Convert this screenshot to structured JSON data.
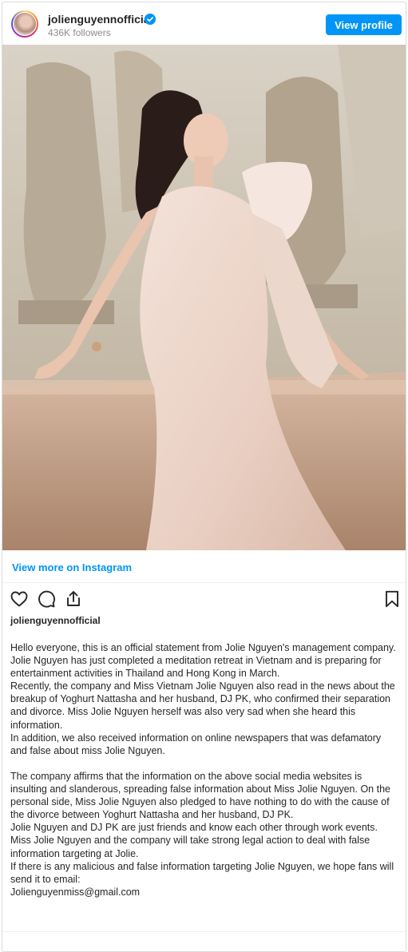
{
  "header": {
    "username": "jolienguyennofficial",
    "followers": "436K followers",
    "view_profile_label": "View profile"
  },
  "post": {
    "view_more_label": "View more on Instagram",
    "owner": "jolienguyennofficial",
    "caption": "Hello everyone, this is an official statement from Jolie Nguyen's management company.\nJolie Nguyen has just completed a meditation retreat in Vietnam and is preparing for entertainment activities in Thailand and Hong Kong in March.\nRecently, the company and Miss Vietnam Jolie Nguyen also read in the news about the breakup of Yoghurt Nattasha and her husband, DJ PK, who confirmed their separation and divorce. Miss Jolie Nguyen herself was also very sad when she heard this information.\nIn addition, we also received information on online newspapers that was defamatory and false about miss Jolie Nguyen.\n\nThe company affirms that the information on the above social media websites is insulting and slanderous, spreading false information about Miss Jolie Nguyen. On the personal side, Miss Jolie Nguyen also pledged to have nothing to do with the cause of the divorce between Yoghurt Nattasha and her husband, DJ PK.\nJolie Nguyen and DJ PK are just friends and know each other through work events. Miss Jolie Nguyen and the company will take strong legal action to deal with false information targeting at Jolie.\nIf there is any malicious and false information targeting Jolie Nguyen, we hope fans will send it to email:\nJolienguyenmiss@gmail.com"
  },
  "icons": {
    "verified": "verified-badge-icon",
    "like": "heart-icon",
    "comment": "comment-bubble-icon",
    "share": "share-icon",
    "save": "bookmark-icon"
  },
  "colors": {
    "accent": "#0095f6",
    "text": "#262626",
    "muted": "#8e8e8e"
  }
}
